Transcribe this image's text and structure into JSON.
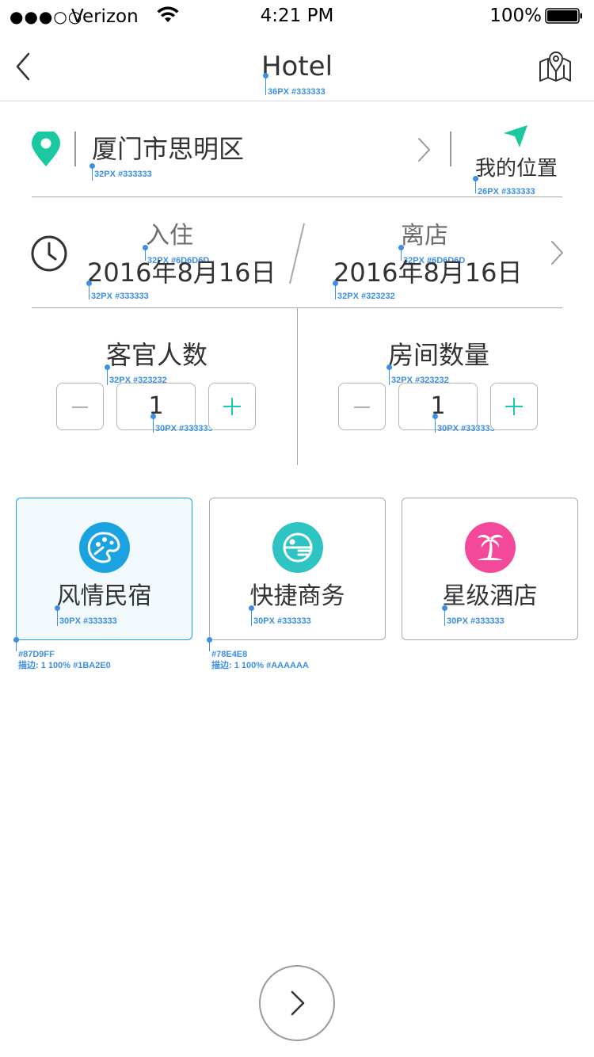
{
  "status_bar": {
    "signal": "●●●○○",
    "carrier": "Verizon",
    "time": "4:21 PM",
    "battery": "100%"
  },
  "nav": {
    "title": "Hotel"
  },
  "location": {
    "city": "厦门市思明区",
    "my_location": "我的位置"
  },
  "dates": {
    "checkin_label": "入住",
    "checkin_value": "2016年8月16日",
    "checkout_label": "离店",
    "checkout_value": "2016年8月16日"
  },
  "guests": {
    "label": "客官人数",
    "value": "1"
  },
  "rooms": {
    "label": "房间数量",
    "value": "1"
  },
  "cards": [
    {
      "label": "风情民宿",
      "icon": "palette-icon",
      "color": "#1ba2e0"
    },
    {
      "label": "快捷商务",
      "icon": "globe-icon",
      "color": "#2ec4c4"
    },
    {
      "label": "星级酒店",
      "icon": "palm-tree-icon",
      "color": "#f4489a"
    }
  ],
  "annotations": {
    "title": "36PX #333333",
    "city": "32PX #333333",
    "my_location": "26PX #333333",
    "checkin_label": "32PX #6D6D6D",
    "checkin_value": "32PX #333333",
    "checkout_label": "32PX #6D6D6D",
    "checkout_value": "32PX #323232",
    "guests_label": "32PX #323232",
    "guests_value": "30PX #333333",
    "rooms_label": "32PX #323232",
    "rooms_value": "30PX #333333",
    "card1_label": "30PX #333333",
    "card2_label": "30PX #333333",
    "card3_label": "30PX #333333",
    "card1_fill": "#87D9FF",
    "card1_stroke": "描边: 1 100% #1BA2E0",
    "card2_fill": "#78E4E8",
    "card2_stroke": "描边: 1 100% #AAAAAA"
  },
  "colors": {
    "accent_green": "#1bc8b4",
    "selected_border": "#1ba2e0",
    "card_border": "#aaaaaa",
    "annotation": "#3d8fe6"
  }
}
